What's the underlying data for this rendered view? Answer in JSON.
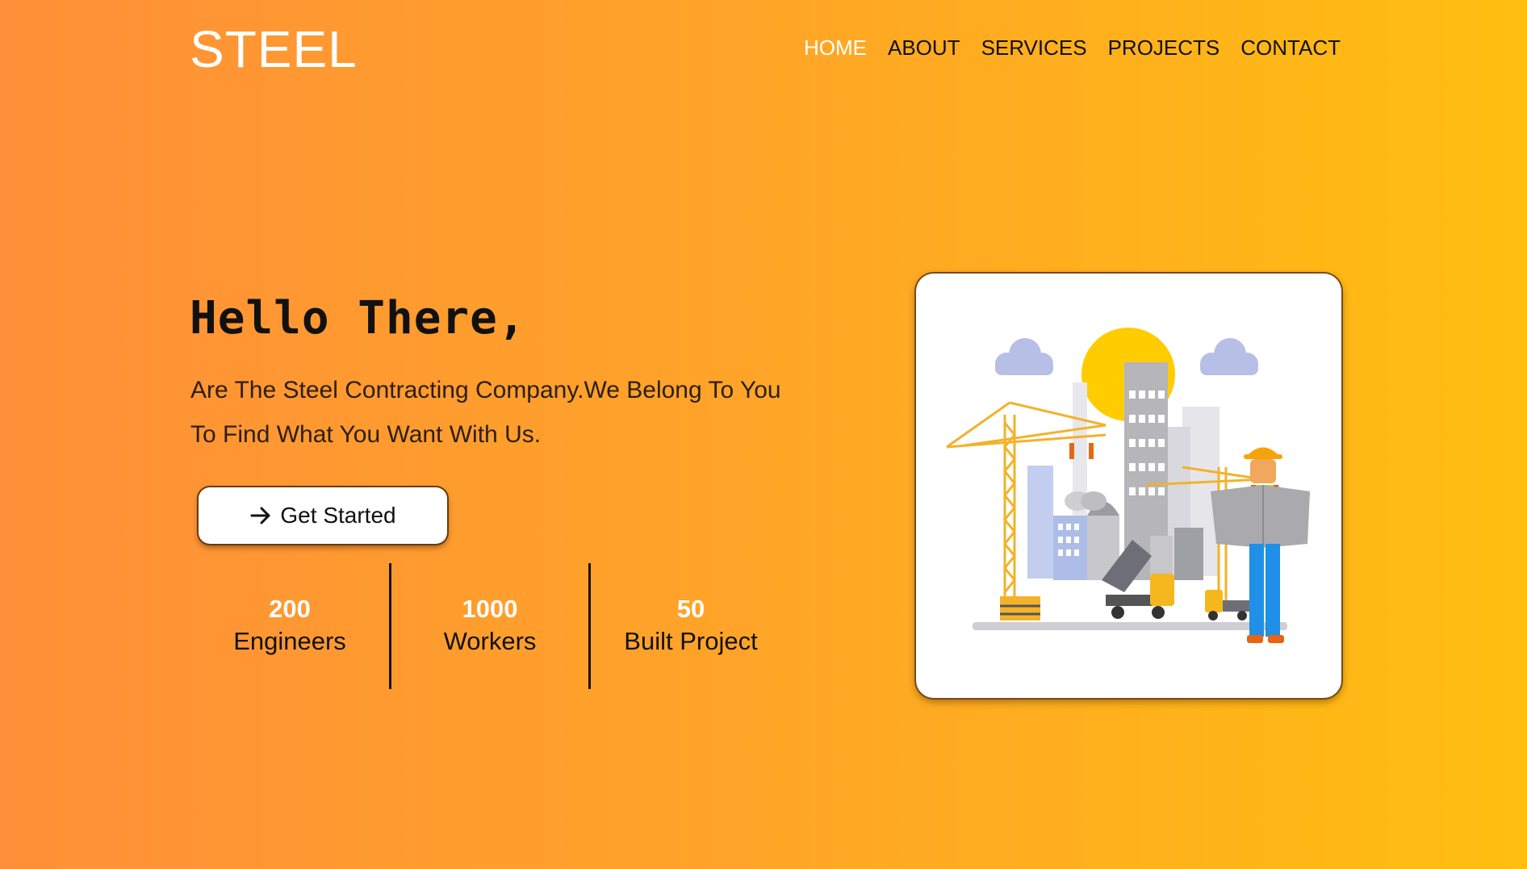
{
  "header": {
    "logo": "STEEL",
    "nav": [
      {
        "label": "HOME",
        "active": true
      },
      {
        "label": "ABOUT",
        "active": false
      },
      {
        "label": "SERVICES",
        "active": false
      },
      {
        "label": "PROJECTS",
        "active": false
      },
      {
        "label": "CONTACT",
        "active": false
      }
    ]
  },
  "hero": {
    "title": "Hello There,",
    "description": "Are The Steel Contracting Company.We Belong To You To Find What You Want With Us.",
    "cta_label": "Get Started",
    "cta_icon": "arrow-right-icon"
  },
  "stats": [
    {
      "value": "200",
      "label": "Engineers"
    },
    {
      "value": "1000",
      "label": "Workers"
    },
    {
      "value": "50",
      "label": "Built Project"
    }
  ],
  "illustration": {
    "icon": "construction-site-illustration"
  },
  "colors": {
    "gradient_start": "#ff8f38",
    "gradient_end": "#ffbe10",
    "active_nav": "#ffffff",
    "text_dark": "#111111"
  }
}
